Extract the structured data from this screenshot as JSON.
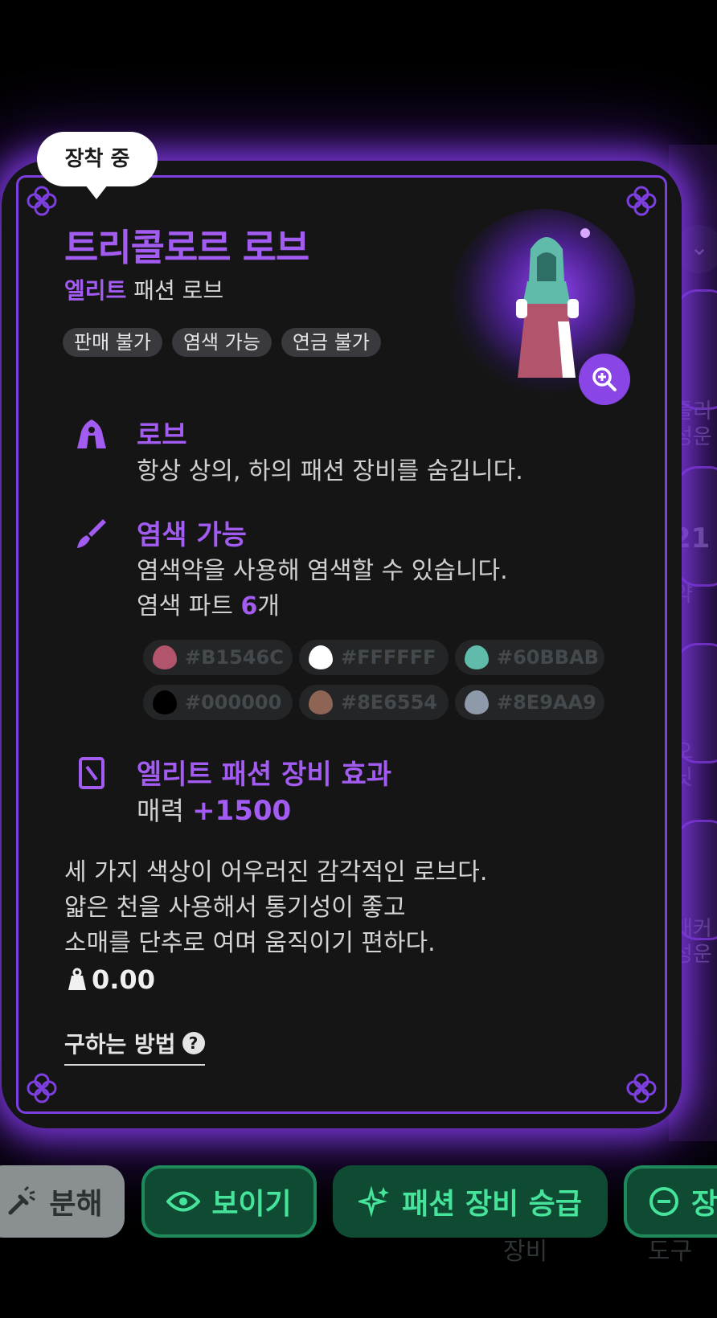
{
  "equipped_badge": "장착 중",
  "item": {
    "name": "트리콜로르 로브",
    "grade": "엘리트",
    "category": "패션 로브",
    "tags": [
      "판매 불가",
      "염색 가능",
      "연금 불가"
    ]
  },
  "sections": {
    "robe": {
      "title": "로브",
      "text": "항상 상의, 하의 패션 장비를 숨깁니다."
    },
    "dye": {
      "title": "염색 가능",
      "text": "염색약을 사용해 염색할 수 있습니다.",
      "parts_prefix": "염색 파트 ",
      "parts_count": "6",
      "parts_suffix": "개",
      "colors": [
        {
          "hex": "#B1546C",
          "color": "#b1546c"
        },
        {
          "hex": "#FFFFFF",
          "color": "#ffffff"
        },
        {
          "hex": "#60BBAB",
          "color": "#60bbab"
        },
        {
          "hex": "#000000",
          "color": "#000000"
        },
        {
          "hex": "#8E6554",
          "color": "#8e6554"
        },
        {
          "hex": "#8E9AA9",
          "color": "#8e9aa9"
        }
      ]
    },
    "effect": {
      "title": "엘리트 패션 장비 효과",
      "stat_label": "매력 ",
      "stat_value": "+1500"
    }
  },
  "description": [
    "세 가지 색상이 어우러진 감각적인 로브다.",
    "얇은 천을 사용해서 통기성이 좋고",
    "소매를 단추로 여며 움직이기 편하다."
  ],
  "price": "0.00",
  "how_to_obtain": "구하는 방법",
  "actions": {
    "disassemble": "분해",
    "show": "보이기",
    "upgrade": "패션 장비 승급",
    "unequip": "장"
  },
  "background_peek": {
    "labels_top": [
      "틀리",
      "성운"
    ],
    "number": "21",
    "label_mid": "약",
    "labels_b1": [
      "오",
      "닛"
    ],
    "labels_b2": [
      "래커",
      "성운"
    ],
    "bottom": [
      "장비",
      "도구"
    ]
  },
  "colors": {
    "accent": "#a35cf2",
    "glow": "#7d3fe0",
    "button_green": "#46e39a",
    "button_bg": "#0f4a33"
  }
}
